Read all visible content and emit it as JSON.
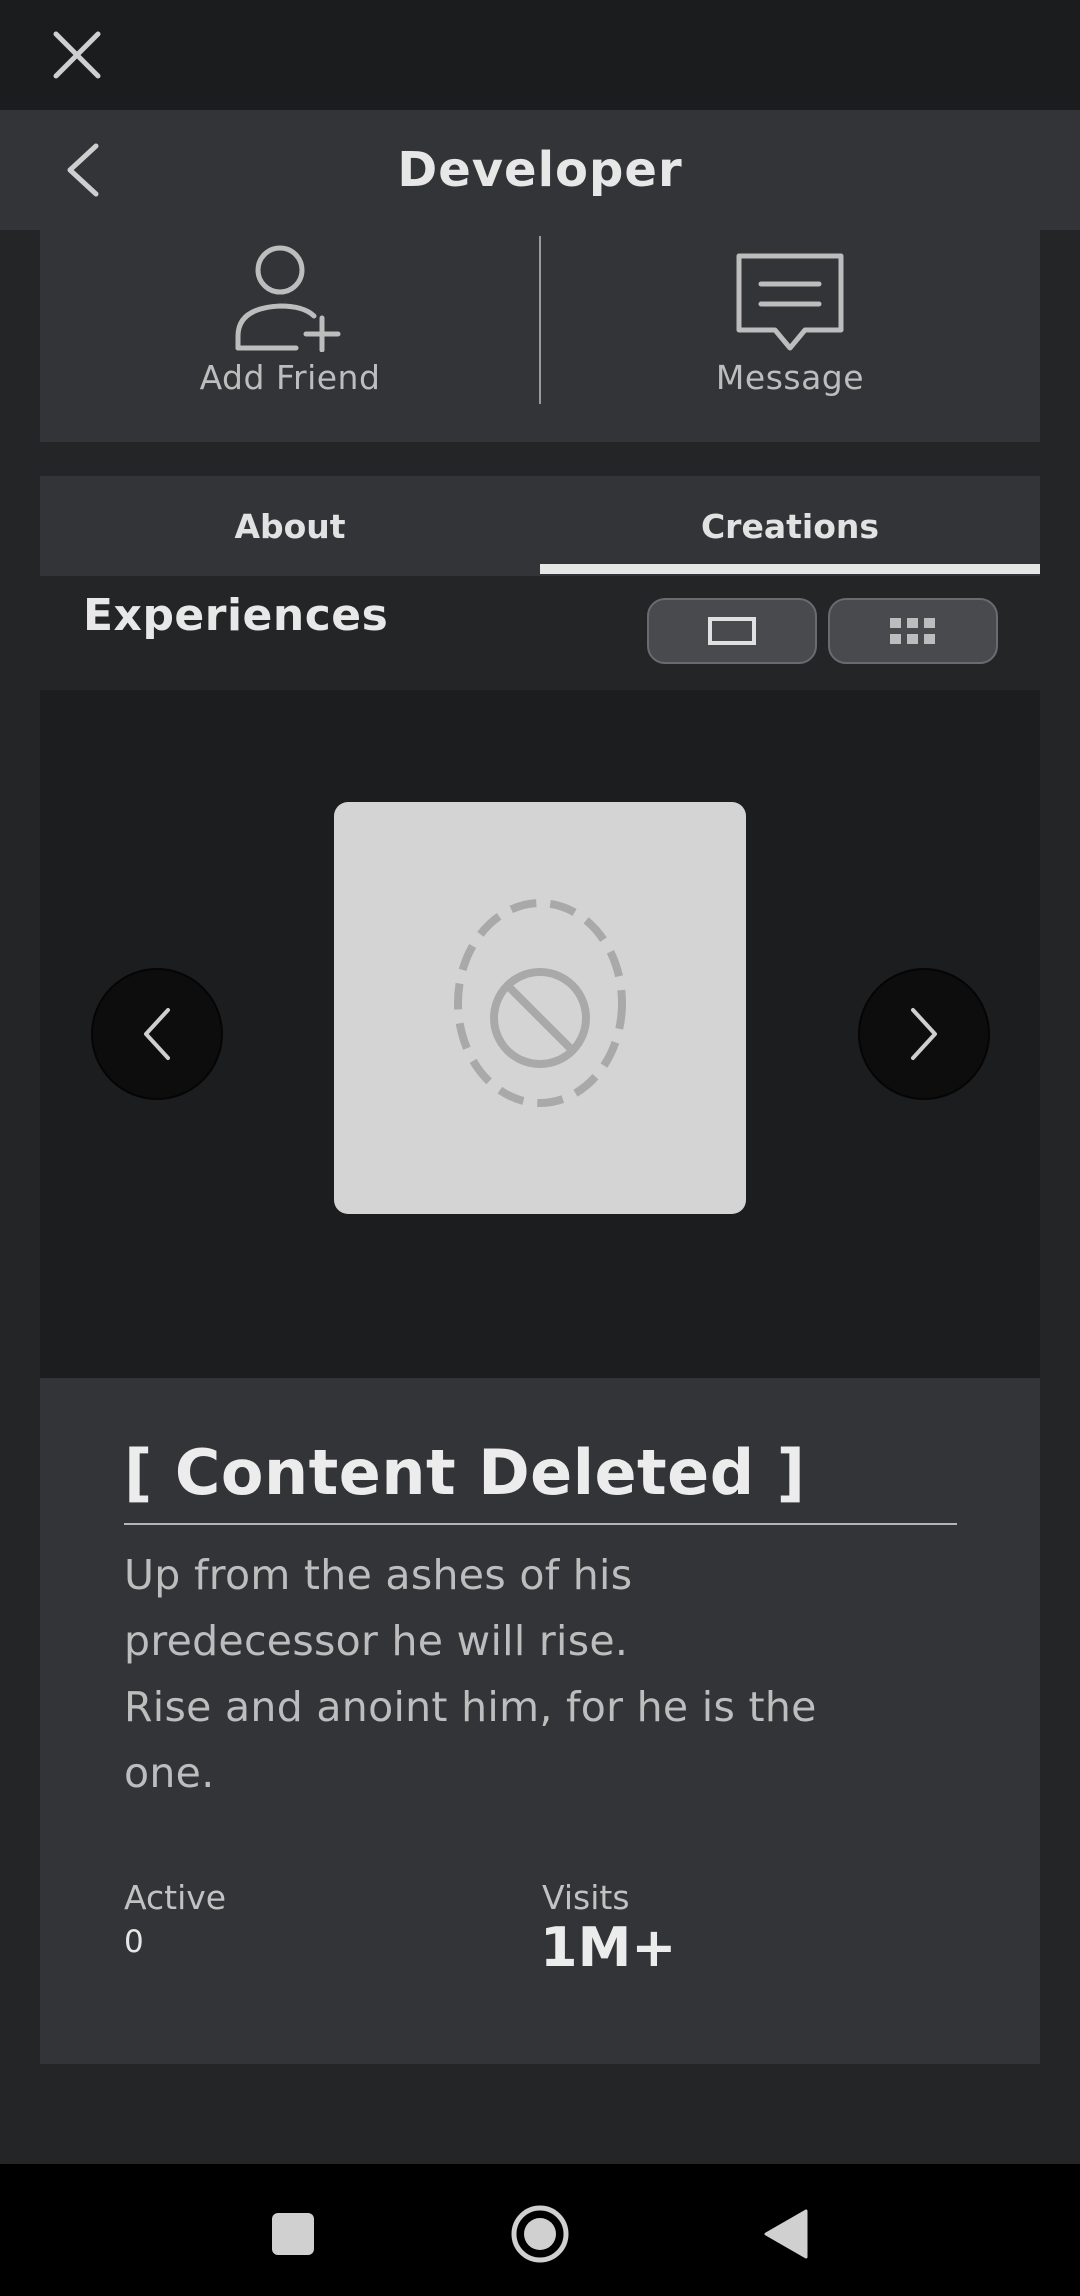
{
  "header": {
    "title": "Developer"
  },
  "actions": [
    {
      "label": "Add Friend",
      "icon": "add-friend-icon"
    },
    {
      "label": "Message",
      "icon": "message-icon"
    }
  ],
  "tabs": [
    {
      "label": "About",
      "active": false
    },
    {
      "label": "Creations",
      "active": true
    }
  ],
  "experiences": {
    "title": "Experiences",
    "view_modes": [
      "single-view",
      "grid-view"
    ],
    "selected_view": "single-view"
  },
  "game": {
    "title": "[ Content Deleted ]",
    "description": "Up from the ashes of his\npredecessor he will rise.\nRise and anoint him, for he is the\none.",
    "active_label": "Active",
    "active_value": "0",
    "visits_label": "Visits",
    "visits_value": "1M+"
  },
  "colors": {
    "background": "#232527",
    "card": "#333437",
    "carousel_bg": "#1c1d1f",
    "thumbnail": "#d4d4d4"
  }
}
